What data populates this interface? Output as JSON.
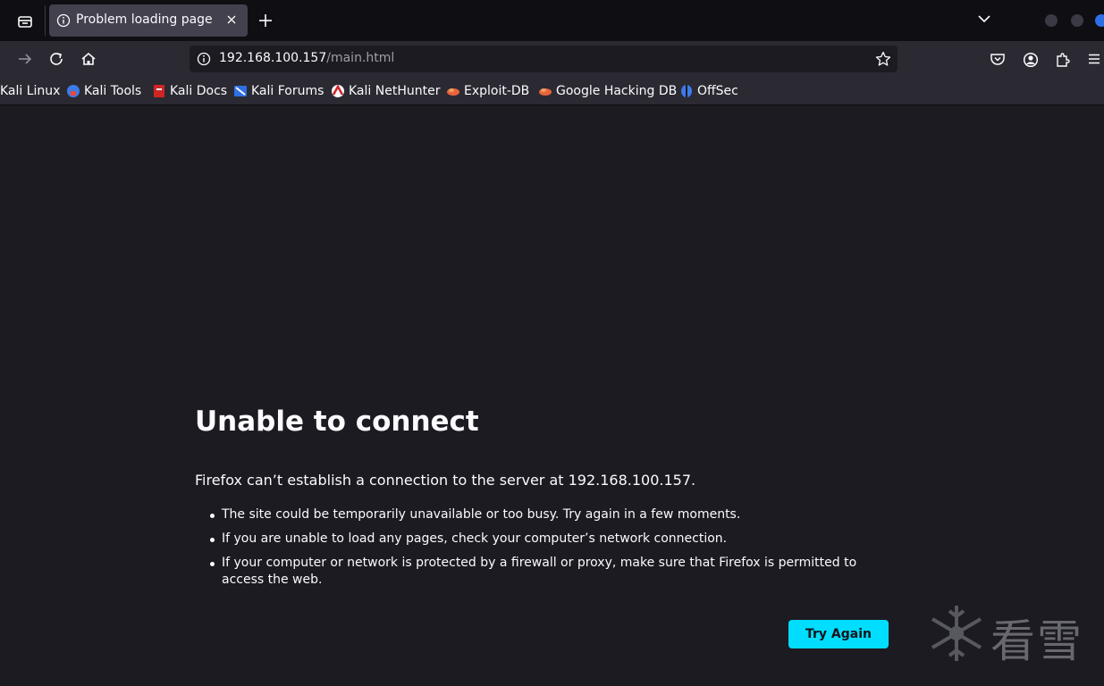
{
  "tabs": [
    {
      "title": "Problem loading page",
      "icon": "info-icon",
      "active": true
    }
  ],
  "address": {
    "host": "192.168.100.157",
    "path": "/main.html"
  },
  "bookmarks": [
    {
      "label": "Kali Linux",
      "icon": "kali-linux-icon"
    },
    {
      "label": "Kali Tools",
      "icon": "kali-tools-icon"
    },
    {
      "label": "Kali Docs",
      "icon": "kali-docs-icon"
    },
    {
      "label": "Kali Forums",
      "icon": "kali-forums-icon"
    },
    {
      "label": "Kali NetHunter",
      "icon": "kali-nethunter-icon"
    },
    {
      "label": "Exploit-DB",
      "icon": "exploit-db-icon"
    },
    {
      "label": "Google Hacking DB",
      "icon": "google-hacking-db-icon"
    },
    {
      "label": "OffSec",
      "icon": "offsec-icon"
    }
  ],
  "error": {
    "title": "Unable to connect",
    "description": "Firefox can’t establish a connection to the server at 192.168.100.157.",
    "items": [
      "The site could be temporarily unavailable or too busy. Try again in a few moments.",
      "If you are unable to load any pages, check your computer’s network connection.",
      "If your computer or network is protected by a firewall or proxy, make sure that Firefox is permitted to access the web."
    ],
    "button_label": "Try Again"
  },
  "watermark": {
    "text": "看雪"
  },
  "colors": {
    "accent": "#00ddff",
    "background": "#1c1b22",
    "toolbar": "#2b2a33",
    "tabbar": "#0f0e13"
  }
}
